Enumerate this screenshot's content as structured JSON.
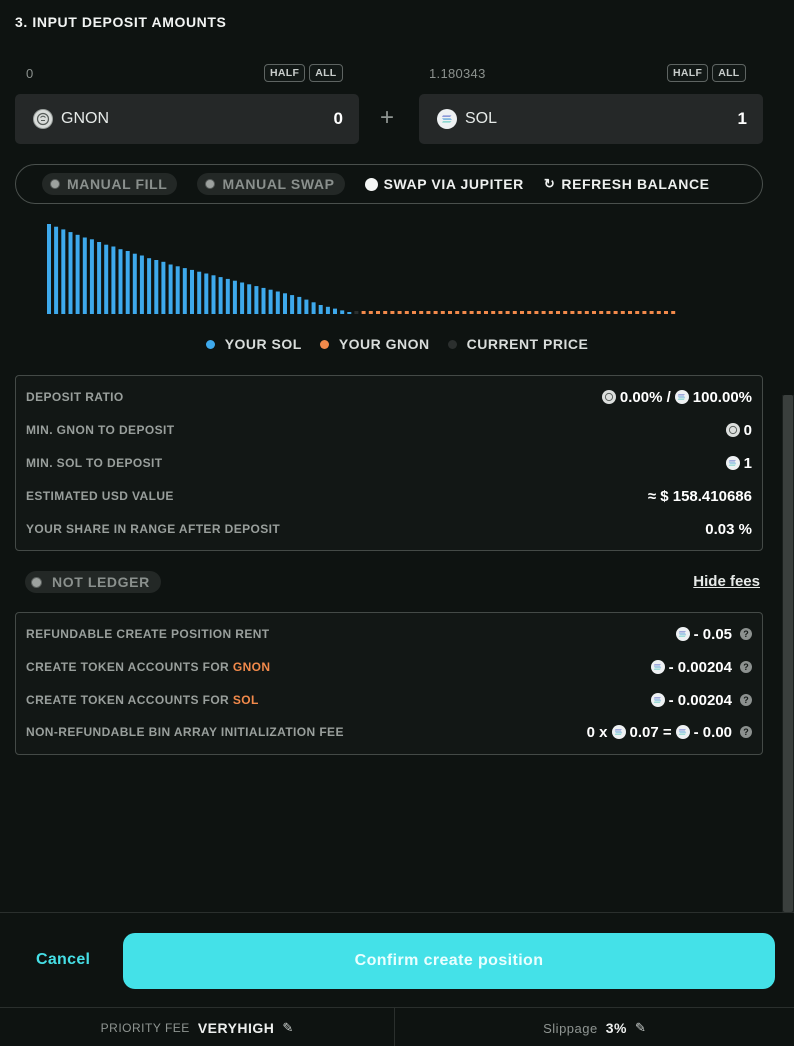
{
  "section": {
    "title": "3. INPUT DEPOSIT AMOUNTS"
  },
  "left_token": {
    "balance": "0",
    "half_label": "HALF",
    "all_label": "ALL",
    "symbol": "GNON",
    "amount": "0",
    "icon": "gnon-token-icon"
  },
  "plus_sign": "+",
  "right_token": {
    "balance": "1.180343",
    "half_label": "HALF",
    "all_label": "ALL",
    "symbol": "SOL",
    "amount": "1",
    "icon": "sol-token-icon"
  },
  "modes": {
    "manual_fill": "MANUAL FILL",
    "manual_swap": "MANUAL SWAP",
    "swap_via_jupiter": "SWAP VIA JUPITER",
    "refresh_balance": "REFRESH BALANCE"
  },
  "distribution_chart": {
    "sol_bins": [
      1.0,
      0.97,
      0.94,
      0.91,
      0.88,
      0.85,
      0.83,
      0.8,
      0.77,
      0.75,
      0.72,
      0.7,
      0.67,
      0.65,
      0.62,
      0.6,
      0.58,
      0.55,
      0.53,
      0.51,
      0.49,
      0.47,
      0.45,
      0.43,
      0.41,
      0.39,
      0.37,
      0.35,
      0.33,
      0.31,
      0.29,
      0.27,
      0.25,
      0.23,
      0.21,
      0.19,
      0.16,
      0.13,
      0.1,
      0.08,
      0.06,
      0.04,
      0.02
    ],
    "gnon_bin_count": 44,
    "colors": {
      "sol": "#3ea9ec",
      "gnon": "#f28a4b",
      "current_price": "#2b2f2e"
    }
  },
  "legend": {
    "sol": "YOUR SOL",
    "gnon": "YOUR GNON",
    "current_price": "CURRENT PRICE"
  },
  "summary": {
    "deposit_ratio_label": "DEPOSIT RATIO",
    "deposit_ratio_gnon": "0.00% /",
    "deposit_ratio_sol": "100.00%",
    "min_gnon_label": "MIN. GNON TO DEPOSIT",
    "min_gnon_value": "0",
    "min_sol_label": "MIN. SOL TO DEPOSIT",
    "min_sol_value": "1",
    "usd_label": "ESTIMATED USD VALUE",
    "usd_value": "≈ $ 158.410686",
    "share_label": "YOUR SHARE IN RANGE AFTER DEPOSIT",
    "share_value": "0.03 %"
  },
  "ledger": {
    "label": "NOT LEDGER"
  },
  "hide_fees": "Hide fees",
  "fees": {
    "rent_label": "REFUNDABLE CREATE POSITION RENT",
    "rent_value": "- 0.05",
    "gnon_accounts_label": "CREATE TOKEN ACCOUNTS FOR",
    "gnon_accounts_token": "GNON",
    "gnon_accounts_value": "- 0.00204",
    "sol_accounts_label": "CREATE TOKEN ACCOUNTS FOR",
    "sol_accounts_token": "SOL",
    "sol_accounts_value": "- 0.00204",
    "bin_fee_label": "NON-REFUNDABLE BIN ARRAY INITIALIZATION FEE",
    "bin_fee_count": "0 x",
    "bin_fee_unit": "0.07 =",
    "bin_fee_total": "- 0.00"
  },
  "actions": {
    "cancel": "Cancel",
    "confirm": "Confirm create position"
  },
  "footer": {
    "priority_fee_label": "PRIORITY FEE",
    "priority_fee_value": "VERYHIGH",
    "slippage_label": "Slippage",
    "slippage_value": "3%"
  }
}
